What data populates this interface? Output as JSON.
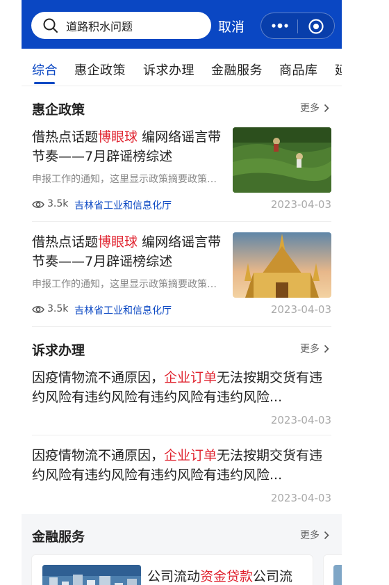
{
  "search": {
    "query": "道路积水问题",
    "cancel_label": "取消"
  },
  "tabs": [
    {
      "label": "综合",
      "active": true
    },
    {
      "label": "惠企政策",
      "active": false
    },
    {
      "label": "诉求办理",
      "active": false
    },
    {
      "label": "金融服务",
      "active": false
    },
    {
      "label": "商品库",
      "active": false
    },
    {
      "label": "延",
      "active": false
    }
  ],
  "policy": {
    "title": "惠企政策",
    "more": "更多",
    "items": [
      {
        "title_pre": "借热点话题",
        "title_hl": "博眼球",
        "title_post": " 编网络谣言带节奏——7月辟谣榜综述",
        "summary": "申报工作的通知，这里显示政策摘要政策摘要",
        "views": "3.5k",
        "source": "吉林省工业和信息化厅",
        "date": "2023-04-03",
        "image": "tea-plantation-photo"
      },
      {
        "title_pre": "借热点话题",
        "title_hl": "博眼球",
        "title_post": " 编网络谣言带节奏——7月辟谣榜综述",
        "summary": "申报工作的通知，这里显示政策摘要政策摘要",
        "views": "3.5k",
        "source": "吉林省工业和信息化厅",
        "date": "2023-04-03",
        "image": "golden-pagoda-photo"
      }
    ]
  },
  "appeal": {
    "title": "诉求办理",
    "more": "更多",
    "items": [
      {
        "text_pre": "因疫情物流不通原因，",
        "text_hl": "企业订单",
        "text_post": "无法按期交货有违约风险有违约风险有违约风险有违约风险...",
        "date": "2023-04-03"
      },
      {
        "text_pre": "因疫情物流不通原因，",
        "text_hl": "企业订单",
        "text_post": "无法按期交货有违约风险有违约风险有违约风险有违约风险...",
        "date": "2023-04-03"
      }
    ]
  },
  "finance": {
    "title": "金融服务",
    "more": "更多",
    "card": {
      "text_pre": "公司流动",
      "text_hl": "资金贷款",
      "text_post": "公司流"
    }
  },
  "colors": {
    "brand": "#0a47c3",
    "highlight": "#e0232f"
  }
}
